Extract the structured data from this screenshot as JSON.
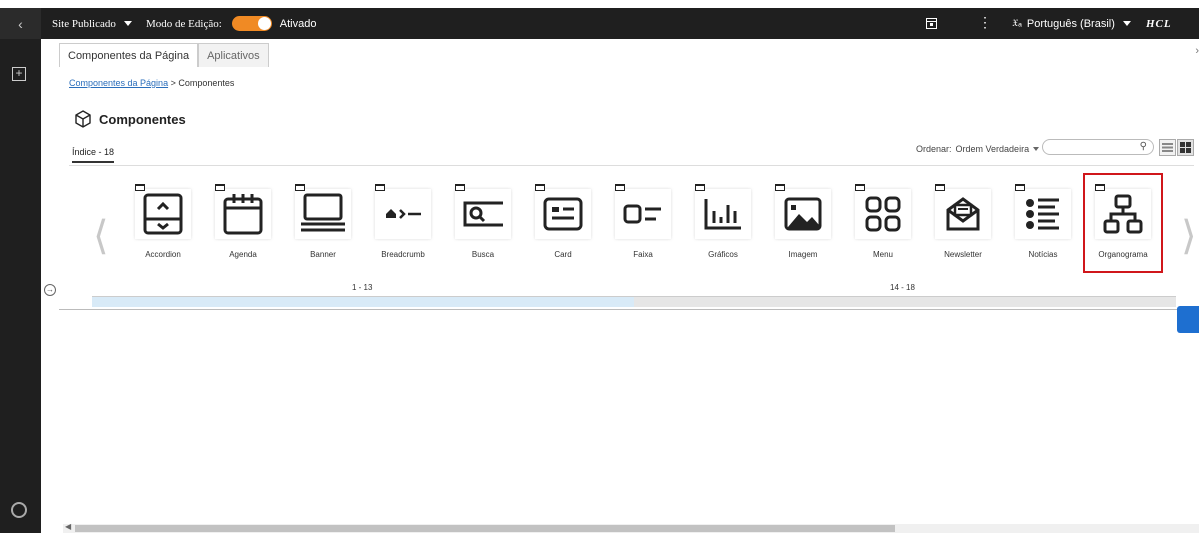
{
  "topbar": {
    "back_icon": "chevron-left-icon",
    "site_label": "Site Publicado",
    "edit_mode_label": "Modo de Edição:",
    "edit_mode_state": "Ativado",
    "language": "Português (Brasil)",
    "brand": "HCL",
    "accent_color": "#f08a24"
  },
  "panel": {
    "tabs": [
      "Componentes da Página",
      "Aplicativos"
    ],
    "breadcrumb": {
      "link": "Componentes da Página",
      "separator": ">",
      "current": "Componentes"
    },
    "title": "Componentes",
    "index_tab": "Índice - 18",
    "sort_label": "Ordenar:",
    "sort_value": "Ordem Verdadeira",
    "search_placeholder": ""
  },
  "components": [
    {
      "label": "Accordion",
      "icon": "accordion-icon"
    },
    {
      "label": "Agenda",
      "icon": "calendar-icon"
    },
    {
      "label": "Banner",
      "icon": "banner-icon"
    },
    {
      "label": "Breadcrumb",
      "icon": "breadcrumb-icon"
    },
    {
      "label": "Busca",
      "icon": "search-icon"
    },
    {
      "label": "Card",
      "icon": "card-icon"
    },
    {
      "label": "Faixa",
      "icon": "strip-icon"
    },
    {
      "label": "Gráficos",
      "icon": "chart-icon"
    },
    {
      "label": "Imagem",
      "icon": "image-icon"
    },
    {
      "label": "Menu",
      "icon": "menu-grid-icon"
    },
    {
      "label": "Newsletter",
      "icon": "newsletter-icon"
    },
    {
      "label": "Notícias",
      "icon": "news-list-icon"
    },
    {
      "label": "Organograma",
      "icon": "org-chart-icon",
      "selected": true
    }
  ],
  "pager": {
    "page1": "1 - 13",
    "page2": "14 - 18",
    "progress": 0.5
  }
}
